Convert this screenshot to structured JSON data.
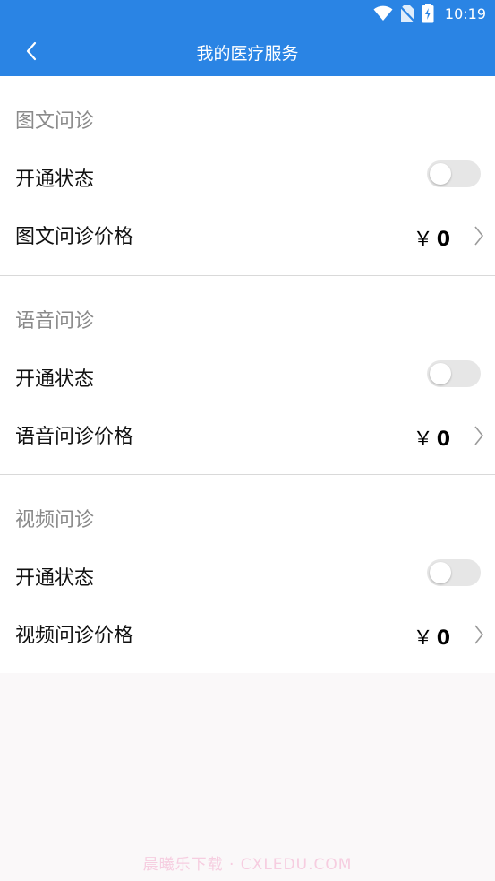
{
  "status_bar": {
    "time": "10:19",
    "icons": [
      "wifi-icon",
      "no-sim-icon",
      "battery-charging-icon"
    ]
  },
  "header": {
    "title": "我的医疗服务",
    "back_icon": "chevron-left-icon"
  },
  "sections": [
    {
      "title": "图文问诊",
      "status_label": "开通状态",
      "status_enabled": false,
      "price_label": "图文问诊价格",
      "currency": "￥",
      "price": "0"
    },
    {
      "title": "语音问诊",
      "status_label": "开通状态",
      "status_enabled": false,
      "price_label": "语音问诊价格",
      "currency": "￥",
      "price": "0"
    },
    {
      "title": "视频问诊",
      "status_label": "开通状态",
      "status_enabled": false,
      "price_label": "视频问诊价格",
      "currency": "￥",
      "price": "0"
    }
  ],
  "watermark": "晨曦乐下载 · CXLEDU.COM",
  "colors": {
    "header_bg": "#2a84e4",
    "page_bg": "#faf8f9",
    "section_title": "#8a8a8a",
    "toggle_off": "#e6e6e6"
  }
}
